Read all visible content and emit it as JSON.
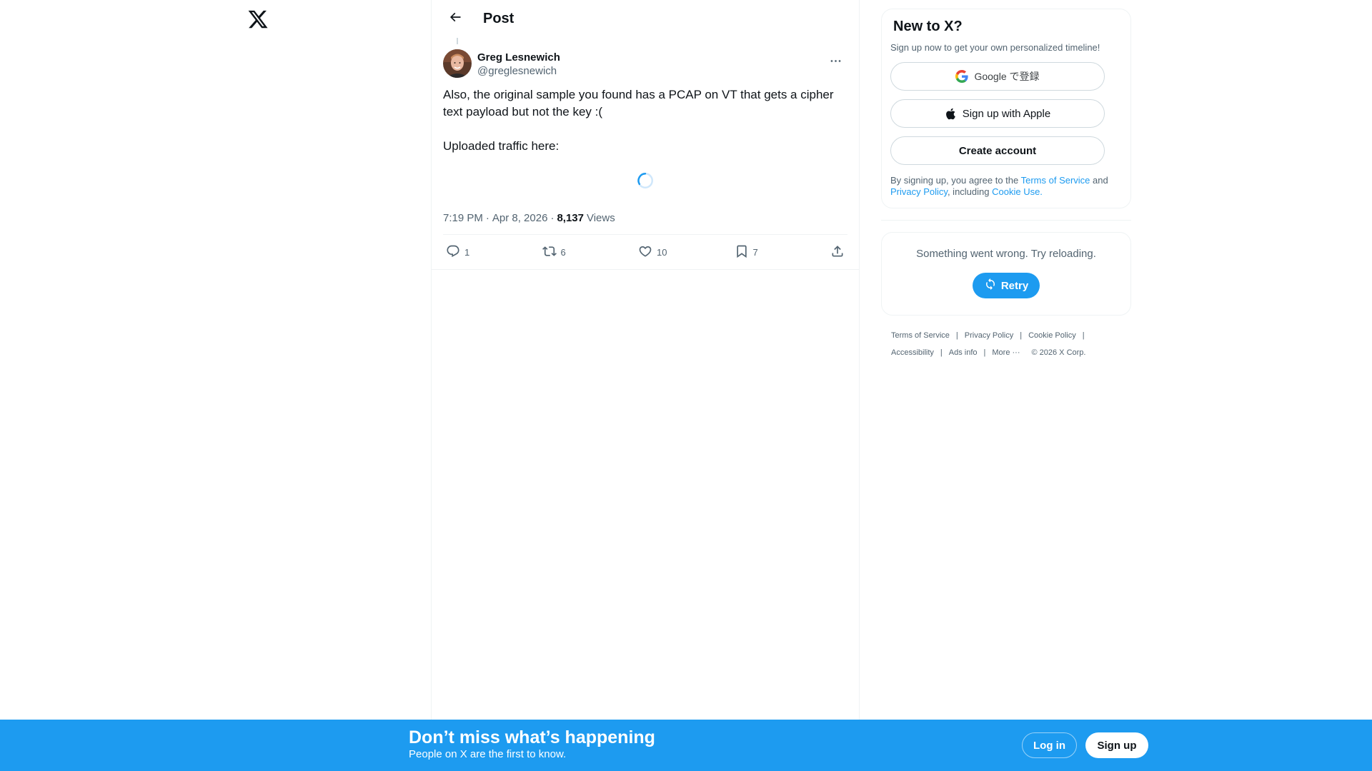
{
  "colors": {
    "accent": "#1d9bf0",
    "text_primary": "#0f1419",
    "text_secondary": "#536471",
    "border": "#eff3f4"
  },
  "nav": {
    "logo_icon": "x-logo-icon"
  },
  "header": {
    "back_icon": "arrow-left-icon",
    "title": "Post"
  },
  "tweet": {
    "author_name": "Greg Lesnewich",
    "author_handle": "@greglesnewich",
    "more_icon": "ellipsis-icon",
    "text": "Also, the original sample you found has a PCAP on VT that gets a cipher text payload but not the key :(\n\nUploaded traffic here:",
    "time": "7:19 PM",
    "date": "Apr 8, 2026",
    "views_count": "8,137",
    "views_label": "Views",
    "actions": {
      "replies": "1",
      "reposts": "6",
      "likes": "10",
      "bookmarks": "7"
    }
  },
  "signup": {
    "title": "New to X?",
    "subtitle": "Sign up now to get your own personalized timeline!",
    "google_label": "Google で登録",
    "apple_label": "Sign up with Apple",
    "create_label": "Create account",
    "legal_prefix": "By signing up, you agree to the ",
    "terms_link": "Terms of Service",
    "legal_and": " and ",
    "privacy_link": "Privacy Policy",
    "legal_including": ", including ",
    "cookie_link": "Cookie Use."
  },
  "error_box": {
    "message": "Something went wrong. Try reloading.",
    "retry_label": "Retry"
  },
  "footer": {
    "links": [
      "Terms of Service",
      "Privacy Policy",
      "Cookie Policy",
      "Accessibility",
      "Ads info",
      "More ···"
    ],
    "copyright": "© 2026 X Corp."
  },
  "bottom_bar": {
    "title": "Don’t miss what’s happening",
    "subtitle": "People on X are the first to know.",
    "login_label": "Log in",
    "signup_label": "Sign up"
  }
}
